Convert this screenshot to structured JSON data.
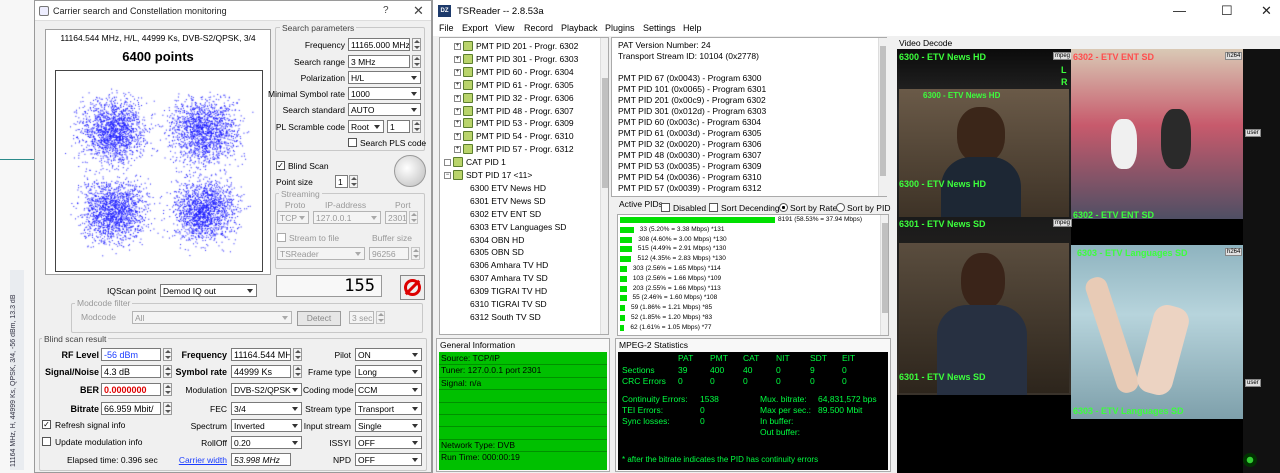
{
  "background": {
    "strip_text": "11164 MHz, H, 44999 Ks, QPSK, 3/4, -56 dBm, 13.3 dB"
  },
  "dialog": {
    "title": "Carrier search and Constellation monitoring",
    "help_label": "?",
    "close_label": "✕",
    "constellation": {
      "info": "11164.544 MHz, H/L, 44999 Ks, DVB-S2/QPSK, 3/4",
      "points": "6400 points",
      "dot_color": "#1a1aff"
    },
    "search_params": {
      "title": "Search parameters",
      "frequency_label": "Frequency",
      "frequency_value": "11165.000 MHz",
      "range_label": "Search range",
      "range_value": "3 MHz",
      "polarization_label": "Polarization",
      "polarization_value": "H/L",
      "min_symrate_label": "Minimal Symbol rate",
      "min_symrate_value": "1000",
      "standard_label": "Search standard",
      "standard_value": "AUTO",
      "pls_label": "PL Scramble code",
      "pls_mode": "Root",
      "pls_value": "1",
      "search_pls_label": "Search PLS code"
    },
    "blind_scan_label": "Blind Scan",
    "point_size_label": "Point size",
    "point_size_value": "1",
    "streaming": {
      "title": "Streaming",
      "proto_label": "Proto",
      "ip_label": "IP-address",
      "port_label": "Port",
      "proto_value": "TCP",
      "ip_value": "127.0.0.1",
      "port_value": "2301",
      "stream_to_file_label": "Stream to file",
      "buffer_label": "Buffer size",
      "file_value": "TSReader",
      "buffer_value": "96256"
    },
    "iq_label": "IQScan point",
    "iq_value": "Demod IQ out",
    "counter": "155",
    "modcode": {
      "title": "Modcode filter",
      "label": "Modcode",
      "value": "All",
      "detect_label": "Detect",
      "sec_value": "3 sec"
    },
    "result": {
      "title": "Blind scan result",
      "rf_label": "RF Level",
      "rf_value": "-56 dBm",
      "sn_label": "Signal/Noise",
      "sn_value": "4.3 dB",
      "ber_label": "BER",
      "ber_value": "0.0000000",
      "bitrate_label": "Bitrate",
      "bitrate_value": "66.959 Mbit/",
      "freq_label": "Frequency",
      "freq_value": "11164.544 MH",
      "symrate_label": "Symbol rate",
      "symrate_value": "44999 Ks",
      "modulation_label": "Modulation",
      "modulation_value": "DVB-S2/QPSK",
      "fec_label": "FEC",
      "fec_value": "3/4",
      "spectrum_label": "Spectrum",
      "spectrum_value": "Inverted",
      "rolloff_label": "RollOff",
      "rolloff_value": "0.20",
      "carrier_width_label": "Carrier width",
      "carrier_width_value": "53.998 MHz",
      "pilot_label": "Pilot",
      "pilot_value": "ON",
      "frame_label": "Frame type",
      "frame_value": "Long",
      "coding_label": "Coding mode",
      "coding_value": "CCM",
      "stream_type_label": "Stream type",
      "stream_type_value": "Transport",
      "input_stream_label": "Input stream",
      "input_stream_value": "Single",
      "issyi_label": "ISSYI",
      "issyi_value": "OFF",
      "npd_label": "NPD",
      "npd_value": "OFF",
      "refresh_label": "Refresh signal info",
      "update_label": "Update modulation info",
      "elapsed": "Elapsed time: 0.396 sec"
    }
  },
  "tsr": {
    "title": "TSReader -- 2.8.53a",
    "logo": "DZ",
    "minimize": "—",
    "maximize": "☐",
    "close": "✕",
    "menu": [
      "File",
      "Export",
      "View",
      "Record",
      "Playback",
      "Plugins",
      "Settings",
      "Help"
    ],
    "tree": [
      {
        "text": "PMT PID 201 - Progr. 6302",
        "type": "pmt"
      },
      {
        "text": "PMT PID 301 - Progr. 6303",
        "type": "pmt"
      },
      {
        "text": "PMT PID 60 - Progr. 6304",
        "type": "pmt"
      },
      {
        "text": "PMT PID 61 - Progr. 6305",
        "type": "pmt"
      },
      {
        "text": "PMT PID 32 - Progr. 6306",
        "type": "pmt"
      },
      {
        "text": "PMT PID 48 - Progr. 6307",
        "type": "pmt"
      },
      {
        "text": "PMT PID 53 - Progr. 6309",
        "type": "pmt"
      },
      {
        "text": "PMT PID 54 - Progr. 6310",
        "type": "pmt"
      },
      {
        "text": "PMT PID 57 - Progr. 6312",
        "type": "pmt"
      },
      {
        "text": "CAT PID 1",
        "type": "cat"
      },
      {
        "text": "SDT PID 17 <11>",
        "type": "sdt"
      },
      {
        "text": "6300 ETV News HD",
        "type": "svc"
      },
      {
        "text": "6301 ETV News SD",
        "type": "svc"
      },
      {
        "text": "6302 ETV ENT SD",
        "type": "svc"
      },
      {
        "text": "6303 ETV Languages SD",
        "type": "svc"
      },
      {
        "text": "6304 OBN HD",
        "type": "svc"
      },
      {
        "text": "6305 OBN SD",
        "type": "svc"
      },
      {
        "text": "6306 Amhara TV HD",
        "type": "svc"
      },
      {
        "text": "6307 Amhara TV SD",
        "type": "svc"
      },
      {
        "text": "6309 TIGRAI TV HD",
        "type": "svc"
      },
      {
        "text": "6310 TIGRAI TV SD",
        "type": "svc"
      },
      {
        "text": "6312 South TV SD",
        "type": "svc"
      }
    ],
    "pat_lines": [
      "PAT Version Number: 24",
      "Transport Stream ID: 10104 (0x2778)",
      "",
      "PMT PID 67 (0x0043) - Program 6300",
      "PMT PID 101 (0x0065) - Program 6301",
      "PMT PID 201 (0x00c9) - Program 6302",
      "PMT PID 301 (0x012d) - Program 6303",
      "PMT PID 60 (0x003c) - Program 6304",
      "PMT PID 61 (0x003d) - Program 6305",
      "PMT PID 32 (0x0020) - Program 6306",
      "PMT PID 48 (0x0030) - Program 6307",
      "PMT PID 53 (0x0035) - Program 6309",
      "PMT PID 54 (0x0036) - Program 6310",
      "PMT PID 57 (0x0039) - Program 6312"
    ],
    "active_pids_label": "Active PIDs",
    "disabled_label": "Disabled",
    "sort_dec_label": "Sort Decending",
    "sort_rate_label": "Sort by Rate",
    "sort_pid_label": "Sort by PID",
    "pid_bars": [
      {
        "label": "8191 (58.53% = 37.94 Mbps)",
        "fraction": 1.0
      },
      {
        "label": "33 (5.20% = 3.38 Mbps) *131",
        "fraction": 0.089
      },
      {
        "label": "308 (4.60% = 3.00 Mbps) *130",
        "fraction": 0.079
      },
      {
        "label": "515 (4.49% = 2.91 Mbps) *130",
        "fraction": 0.077
      },
      {
        "label": "512 (4.35% = 2.83 Mbps) *130",
        "fraction": 0.074
      },
      {
        "label": "303 (2.56% = 1.65 Mbps) *114",
        "fraction": 0.044
      },
      {
        "label": "103 (2.56% = 1.66 Mbps) *109",
        "fraction": 0.044
      },
      {
        "label": "203 (2.55% = 1.66 Mbps) *113",
        "fraction": 0.044
      },
      {
        "label": "55 (2.46% = 1.60 Mbps) *108",
        "fraction": 0.042
      },
      {
        "label": "59 (1.86% = 1.21 Mbps) *85",
        "fraction": 0.032
      },
      {
        "label": "52 (1.85% = 1.20 Mbps) *83",
        "fraction": 0.032
      },
      {
        "label": "62 (1.61% = 1.05 Mbps) *77",
        "fraction": 0.028
      }
    ],
    "general_info": {
      "title": "General Information",
      "lines": [
        "Source: TCP/IP",
        "Tuner: 127.0.0.1 port 2301",
        "Signal: n/a",
        "",
        "",
        "",
        "",
        "Network Type: DVB",
        "Run Time: 000:00:19"
      ]
    },
    "mpeg_stats": {
      "title": "MPEG-2 Statistics",
      "headers": [
        "PAT",
        "PMT",
        "CAT",
        "NIT",
        "SDT",
        "EIT"
      ],
      "rows": [
        {
          "label": "Sections",
          "values": [
            "39",
            "400",
            "40",
            "0",
            "9",
            "0"
          ]
        },
        {
          "label": "CRC Errors",
          "values": [
            "0",
            "0",
            "0",
            "0",
            "0",
            "0"
          ]
        }
      ],
      "continuity_label": "Continuity Errors:",
      "continuity_value": "1538",
      "tei_label": "TEI Errors:",
      "tei_value": "0",
      "sync_label": "Sync losses:",
      "sync_value": "0",
      "mux_label": "Mux. bitrate:",
      "mux_value": "64,831,572 bps",
      "maxsec_label": "Max per sec.:",
      "maxsec_value": "89.500 Mbit",
      "inbuf_label": "In buffer:",
      "outbuf_label": "Out buffer:",
      "footnote": "* after the bitrate indicates the PID has continuity errors"
    },
    "video": {
      "title": "Video Decode",
      "tiles": [
        {
          "title": "6300 - ETV News HD",
          "sub": "6300 - ETV News HD",
          "caption": "6300 - ETV News HD",
          "badge": "mpeg"
        },
        {
          "title": "6302 - ETV ENT SD",
          "caption": "6302 - ETV ENT SD",
          "badge": "h264"
        },
        {
          "title": "6301 - ETV News SD",
          "caption": "6301 - ETV News SD",
          "badge": "mpeg"
        },
        {
          "title": "6303 - ETV Languages SD",
          "caption": "6303 - ETV Languages SD",
          "badge": "h264"
        }
      ],
      "l_label": "L",
      "r_label": "R",
      "user_label": "user"
    }
  }
}
